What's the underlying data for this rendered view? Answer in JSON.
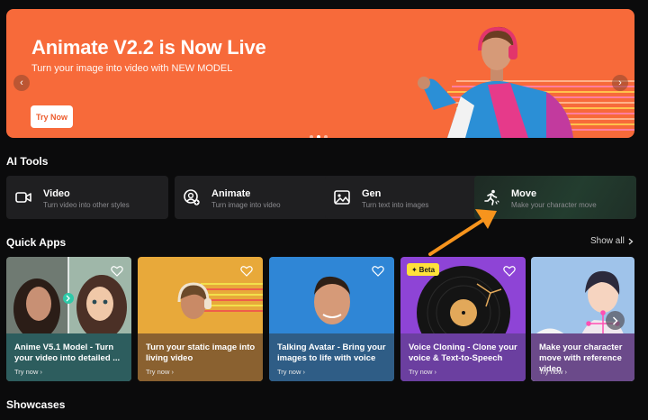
{
  "hero": {
    "title": "Animate V2.2 is Now Live",
    "subtitle": "Turn your image into video with NEW MODEL",
    "button_label": "Try Now",
    "prev_glyph": "‹",
    "next_glyph": "›",
    "slide_count": 3,
    "active_slide": 2,
    "color": "#f76a3a"
  },
  "ai_tools": {
    "heading": "AI Tools",
    "items": [
      {
        "name": "Video",
        "desc": "Turn video into other styles",
        "icon": "video-camera-icon"
      },
      {
        "name": "Animate",
        "desc": "Turn image into video",
        "icon": "animate-portrait-icon"
      },
      {
        "name": "Gen",
        "desc": "Turn text into images",
        "icon": "image-icon"
      },
      {
        "name": "Move",
        "desc": "Make your character move",
        "icon": "running-figure-icon"
      }
    ]
  },
  "quick_apps": {
    "heading": "Quick Apps",
    "show_all": "Show all",
    "items": [
      {
        "title": "Anime V5.1 Model - Turn your video into detailed ...",
        "cta": "Try now",
        "caption_color": "#2d5d5e"
      },
      {
        "title": "Turn your static image into living video",
        "cta": "Try now",
        "caption_color": "#8a6130"
      },
      {
        "title": "Talking Avatar - Bring your images to life with voice",
        "cta": "Try now",
        "caption_color": "#2f5d86"
      },
      {
        "title": "Voice Cloning - Clone your voice & Text-to-Speech",
        "cta": "Try now",
        "caption_color": "#6b3fa0",
        "badge": "Beta"
      },
      {
        "title": "Make your character move with reference video",
        "cta": "Try now",
        "caption_color": "#6b4a8a"
      }
    ]
  },
  "showcases": {
    "heading": "Showcases"
  },
  "colors": {
    "accent_orange": "#f7941d",
    "background": "#0b0b0c"
  }
}
